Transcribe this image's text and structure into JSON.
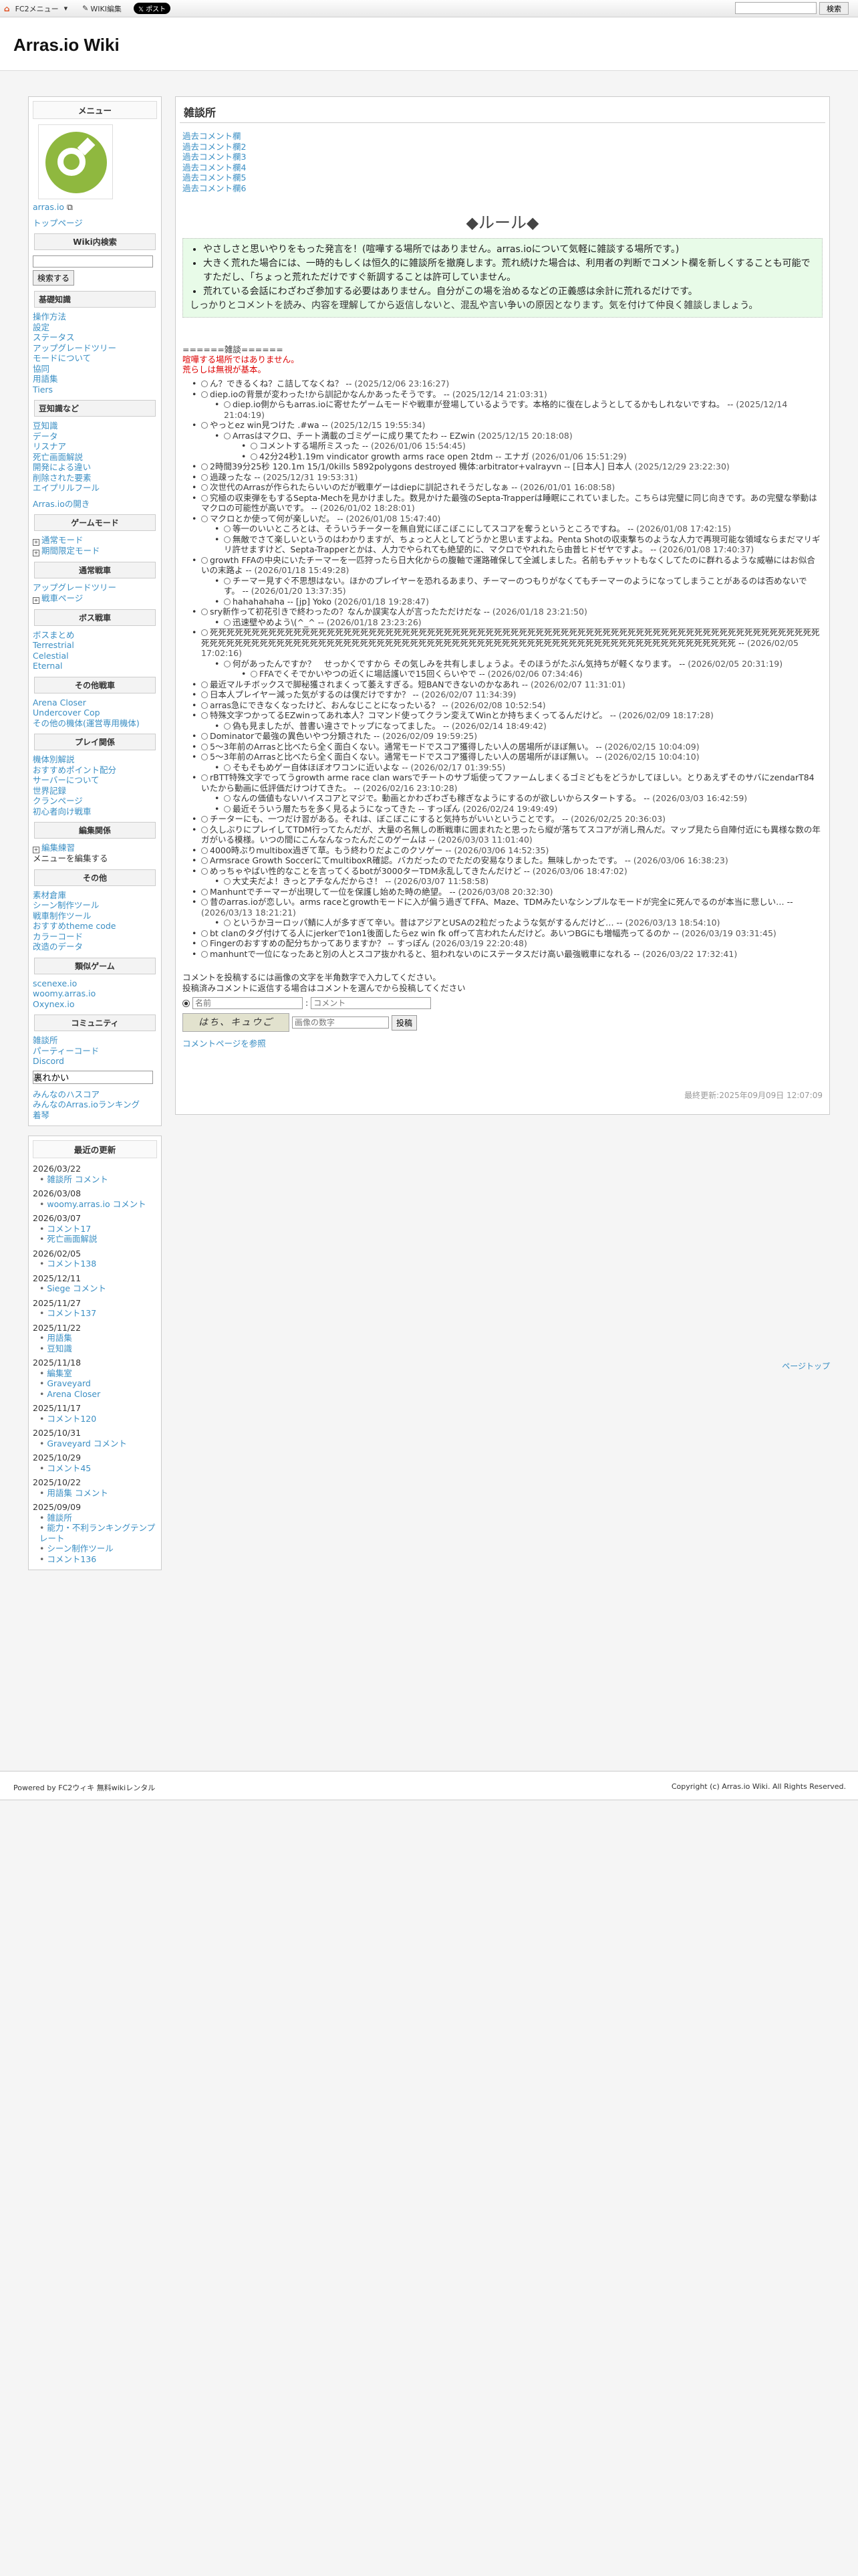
{
  "topbar": {
    "fc2_menu": "FC2メニュー",
    "wiki_edit": "WIKI編集",
    "x_post": "ポスト",
    "search_button": "検索"
  },
  "header": {
    "title": "Arras.io Wiki"
  },
  "sidebar": {
    "menu_title": "メニュー",
    "user": "arras.io",
    "top_page": "トップページ",
    "wiki_search_title": "Wiki内検索",
    "search_button": "検索する",
    "groups": [
      {
        "title": "基礎知識",
        "items": [
          "操作方法",
          "設定",
          "ステータス",
          "アップグレードツリー",
          "モードについて",
          "協同",
          "用語集",
          "Tiers"
        ]
      },
      {
        "title": "豆知識など",
        "items": [
          "豆知識",
          "データ",
          "リスナア",
          "死亡画面解説",
          "開発による違い",
          "削除された要素",
          "エイプリルフール"
        ]
      }
    ],
    "arras_link": "Arras.ioの開き",
    "game_mode_title": "ゲームモード",
    "game_mode_items": [
      "通常モード",
      "期間限定モード"
    ],
    "normal_title": "通常戦車",
    "normal_items": [
      "アップグレードツリー",
      "戦車ページ"
    ],
    "boss_title": "ボス戦車",
    "boss_items": [
      "ボスまとめ",
      "Terrestrial",
      "Celestial",
      "Eternal"
    ],
    "other_title": "その他戦車",
    "other_items": [
      "Arena Closer",
      "Undercover Cop",
      "その他の機体(運営専用機体)"
    ],
    "play_title": "プレイ関係",
    "play_items": [
      "機体別解説",
      "おすすめポイント配分",
      "サーバーについて",
      "世界記録",
      "クランページ",
      "初心者向け戦車"
    ],
    "edit_title": "編集関係",
    "edit_items": [
      "編集練習",
      "メニューを編集する"
    ],
    "misc_title": "その他",
    "misc_items": [
      "素材倉庫",
      "シーン制作ツール",
      "戦車制作ツール",
      "おすすめtheme code",
      "カラーコード",
      "改造のデータ"
    ],
    "similar_title": "類似ゲーム",
    "similar_items": [
      "scenexe.io",
      "woomy.arras.io",
      "Oxynex.io"
    ],
    "community_title": "コミュニティ",
    "community_items": [
      "雑談所",
      "パーティーコード",
      "Discord"
    ],
    "fill_title": "裏れかい",
    "bottom_links": [
      "みんなのハスコア",
      "みんなのArras.ioランキング",
      "着琴"
    ],
    "recent_title": "最近の更新",
    "recent": [
      {
        "date": "2026/03/22",
        "items": [
          "雑談所 コメント"
        ]
      },
      {
        "date": "2026/03/08",
        "items": [
          "woomy.arras.io コメント"
        ]
      },
      {
        "date": "2026/03/07",
        "items": [
          "コメント17",
          "死亡画面解説"
        ]
      },
      {
        "date": "2026/02/05",
        "items": [
          "コメント138"
        ]
      },
      {
        "date": "2025/12/11",
        "items": [
          "Siege コメント"
        ]
      },
      {
        "date": "2025/11/27",
        "items": [
          "コメント137"
        ]
      },
      {
        "date": "2025/11/22",
        "items": [
          "用語集",
          "豆知識"
        ]
      },
      {
        "date": "2025/11/18",
        "items": [
          "編集室",
          "Graveyard",
          "Arena Closer"
        ]
      },
      {
        "date": "2025/11/17",
        "items": [
          "コメント120"
        ]
      },
      {
        "date": "2025/10/31",
        "items": [
          "Graveyard コメント"
        ]
      },
      {
        "date": "2025/10/29",
        "items": [
          "コメント45"
        ]
      },
      {
        "date": "2025/10/22",
        "items": [
          "用語集 コメント"
        ]
      },
      {
        "date": "2025/09/09",
        "items": [
          "雑談所",
          "能力・不利ランキングテンプレート",
          "シーン制作ツール",
          "コメント136"
        ]
      }
    ]
  },
  "main": {
    "title": "雑談所",
    "past_links": [
      "過去コメント欄",
      "過去コメント欄2",
      "過去コメント欄3",
      "過去コメント欄4",
      "過去コメント欄5",
      "過去コメント欄6"
    ],
    "rules_heading": "◆ルール◆",
    "rules": [
      "やさしさと思いやりをもった発言を！(喧嘩する場所ではありません。arras.ioについて気軽に雑談する場所です。)",
      "大きく荒れた場合には、一時的もしくは恒久的に雑談所を撤廃します。荒れ続けた場合は、利用者の判断でコメント欄を新しくすることも可能ですただし、「ちょっと荒れただけですぐ新調することは許可していません。",
      "荒れている会話にわざわざ参加する必要はありません。自分がこの場を治めるなどの正義感は余計に荒れるだけです。"
    ],
    "rules_last": "しっかりとコメントを読み、内容を理解してから返信しないと、混乱や言い争いの原因となります。気を付けて仲良く雑談しましょう。",
    "comment_head": "======雑談======",
    "comment_warn1": "喧嘩する場所ではありません。",
    "comment_warn2": "荒らしは無視が基本。",
    "comments": [
      {
        "lv": 0,
        "text": "ん？できるくね？こ詰してなくね？ --",
        "date": "(2025/12/06 23:16:27)"
      },
      {
        "lv": 0,
        "text": "diep.ioの背景が変わった!から訓記かなんかあったそうです。 --",
        "date": "(2025/12/14 21:03:31)"
      },
      {
        "lv": 1,
        "text": "diep.io側からもarras.ioに寄せたゲームモードや戦車が登場しているようです。本格的に復在しようとしてるかもしれないですね。 --",
        "date": "(2025/12/14 21:04:19)"
      },
      {
        "lv": 0,
        "text": "やっとez win見つけた .#wa --",
        "date": "(2025/12/15 19:55:34)"
      },
      {
        "lv": 1,
        "text": "Arrasはマクロ、チート満載のゴミゲーに成り果てたわ -- EZwin",
        "date": "(2025/12/15 20:18:08)"
      },
      {
        "lv": 2,
        "text": "コメントする場所ミスった --",
        "date": "(2026/01/06 15:54:45)"
      },
      {
        "lv": 2,
        "text": "42分24秒1.19m vindicator growth arms race open 2tdm -- エナガ",
        "date": "(2026/01/06 15:51:29)"
      },
      {
        "lv": 0,
        "text": "2時間39分25秒 120.1m 15/1/0kills 5892polygons destroyed 機体:arbitrator+valrayvn -- [日本人] 日本人",
        "date": "(2025/12/29 23:22:30)"
      },
      {
        "lv": 0,
        "text": "過疎ったな --",
        "date": "(2025/12/31 19:53:31)"
      },
      {
        "lv": 0,
        "text": "次世代のArrasが作られたらいいのだが戦車ゲーはdiepに訓記されそうだしなぁ --",
        "date": "(2026/01/01 16:08:58)"
      },
      {
        "lv": 0,
        "text": "究極の収束弾をもするSepta-Mechを見かけました。数見かけた最強のSepta-Trapperは睡眠にこれていました。こちらは完璧に同じ向きです。あの完璧な挙動はマクロの可能性が高いです。 --",
        "date": "(2026/01/02 18:28:01)"
      },
      {
        "lv": 0,
        "text": "マクロとか使って何が楽しいだ。 --",
        "date": "(2026/01/08 15:47:40)"
      },
      {
        "lv": 1,
        "text": "等一のいいところとは、そういうチーターを無自覚にぼこぼこにしてスコアを奪うというところですね。 --",
        "date": "(2026/01/08 17:42:15)"
      },
      {
        "lv": 1,
        "text": "無敵でさて楽しいというのはわかりますが、ちょっと人としてどうかと思いますよね。Penta Shotの収束撃ちのような人力で再現可能な領域ならまだマリギリ許せますけど、Septa-Trapperとかは、人力でやられても絶望的に、マクロでやれれたら由普ヒドゼヤですよ。 --",
        "date": "(2026/01/08 17:40:37)"
      },
      {
        "lv": 0,
        "text": "growth FFAの中央にいたチーマーを一匹狩ったら日大化からの腹軸で運路確保して全滅しました。名前もチャットもなくしてたのに群れるような威嚇にはお似合いの末路よ --",
        "date": "(2026/01/18 15:49:28)"
      },
      {
        "lv": 1,
        "text": "チーマー見すぐ不思想はない。ほかのプレイヤーを恐れるあまり、チーマーのつもりがなくてもチーマーのようになってしまうことがあるのは否めないです。 --",
        "date": "(2026/01/20 13:37:35)"
      },
      {
        "lv": 1,
        "text": "hahahahaha -- [jp] Yoko",
        "date": "(2026/01/18 19:28:47)"
      },
      {
        "lv": 0,
        "text": "sry新作って初花引きで終わったの？なんか誤実な人が言ったただけだな --",
        "date": "(2026/01/18 23:21:50)"
      },
      {
        "lv": 1,
        "text": "迅速壁やめよう\\(^_^ --",
        "date": "(2026/01/18 23:23:26)"
      },
      {
        "lv": 0,
        "text": "死死死死死死死死死死死死死死死死死死死死死死死死死死死死死死死死死死死死死死死死死死死死死死死死死死死死死死死死死死死死死死死死死死死死死死死死死死死死死死死死死死死死死死死死死死死死死死死死死死死死死死死死死死死死死死死死死死死死死死死死死死死死死死死死死死死死死死死死死 --",
        "date": "(2026/02/05 17:02:16)"
      },
      {
        "lv": 1,
        "text": "何があったんですか？　せっかくですから その気しみを共有しましょうよ。そのほうがたぶん気持ちが軽くなります。 --",
        "date": "(2026/02/05 20:31:19)"
      },
      {
        "lv": 2,
        "text": "FFAでくそでかいやつの近くに場話護いで15回くらいやで --",
        "date": "(2026/02/06 07:34:46)"
      },
      {
        "lv": 0,
        "text": "最近マルチボックスで脚秘獲されまくって萎えすぎる。短BANできないのかなあれ --",
        "date": "(2026/02/07 11:31:01)"
      },
      {
        "lv": 0,
        "text": "日本人プレイヤー減った気がするのは僕だけですか？ --",
        "date": "(2026/02/07 11:34:39)"
      },
      {
        "lv": 0,
        "text": "arras急にできなくなったけど、おんなじことになったいる？ --",
        "date": "(2026/02/08 10:52:54)"
      },
      {
        "lv": 0,
        "text": "特殊文字つかってるEZwinってあれ本人？コマンド使ってクラン変えてWinとか持ちまくってるんだけど。 --",
        "date": "(2026/02/09 18:17:28)"
      },
      {
        "lv": 1,
        "text": "偽も見ましたが、普書い違さでトップになってました。 --",
        "date": "(2026/02/14 18:49:42)"
      },
      {
        "lv": 0,
        "text": "Dominatorで最強の異色いやつ分類された --",
        "date": "(2026/02/09 19:59:25)"
      },
      {
        "lv": 0,
        "text": "5〜3年前のArrasと比べたら全く面白くない。通常モードでスコア獲得したい人の居場所がほぼ無い。 --",
        "date": "(2026/02/15 10:04:09)"
      },
      {
        "lv": 0,
        "text": "5〜3年前のArrasと比べたら全く面白くない。通常モードでスコア獲得したい人の居場所がほぼ無い。 --",
        "date": "(2026/02/15 10:04:10)"
      },
      {
        "lv": 1,
        "text": "そもそもめゲー自体ほぼオワコンに近いよな --",
        "date": "(2026/02/17 01:39:55)"
      },
      {
        "lv": 0,
        "text": "rBTT特殊文字でってうgrowth arme race clan warsでチートのサブ垢使ってファームしまくるゴミどもをどうかしてほしい。とりあえずそのサバにzendarT84いたから動画に低評価だけつけてきた。 --",
        "date": "(2026/02/16 23:10:28)"
      },
      {
        "lv": 1,
        "text": "なんの価値もないハイスコアとマジで。動画とかわざわざも稼ぎなようにするのが欲しいからスタートする。 --",
        "date": "(2026/03/03 16:42:59)"
      },
      {
        "lv": 1,
        "text": "最近そういう層たちを多く見るようになってきた -- すっぽん",
        "date": "(2026/02/24 19:49:49)"
      },
      {
        "lv": 0,
        "text": "チーターにも、一つだけ習がある。それは、ぼこぼこにすると気持ちがいいということです。 --",
        "date": "(2026/02/25 20:36:03)"
      },
      {
        "lv": 0,
        "text": "久しぶりにプレイしてTDM行ってたんだが、大量の名無しの断戦車に囲まれたと思ったら縦が落ちてスコアが消し飛んだ。マップ見たら自陣付近にも異様な数の年ガがいる模様。いつの間にこんなんなったんだこのゲームは --",
        "date": "(2026/03/03 11:01:40)"
      },
      {
        "lv": 0,
        "text": "4000時ぶりmultibox過ぎて草。もう終わりだよこのクソゲー --",
        "date": "(2026/03/06 14:52:35)"
      },
      {
        "lv": 0,
        "text": "Armsrace Growth SoccerにてmultiboxR確認。バカだったのでただの安易なりました。無味しかったです。 --",
        "date": "(2026/03/06 16:38:23)"
      },
      {
        "lv": 0,
        "text": "めっちゃやばい性的なことを言ってくるbotが3000ターTDM永乱してきたんだけど --",
        "date": "(2026/03/06 18:47:02)"
      },
      {
        "lv": 1,
        "text": "大丈夫だよ！きっとアチなんだからさ！ --",
        "date": "(2026/03/07 11:58:58)"
      },
      {
        "lv": 0,
        "text": "Manhuntでチーマーが出現して一位を保護し始めた時の絶望。 --",
        "date": "(2026/03/08 20:32:30)"
      },
      {
        "lv": 0,
        "text": "昔のarras.ioが恋しい。arms raceとgrowthモードに入が偏う過ぎてFFA、Maze、TDMみたいなシンプルなモードが完全に死んでるのが本当に悲しい… --",
        "date": "(2026/03/13 18:21:21)"
      },
      {
        "lv": 1,
        "text": "というかヨーロッパ鯖に人が多すぎて辛い。昔はアジアとUSAの2粒だったような気がするんだけど… --",
        "date": "(2026/03/13 18:54:10)"
      },
      {
        "lv": 0,
        "text": "bt clanのタグ付けてる人にjerkerで1on1後面したらez win fk offって言われたんだけど。あいつBGにも増幅売ってるのか --",
        "date": "(2026/03/19 03:31:45)"
      },
      {
        "lv": 0,
        "text": "Fingerのおすすめの配分ちかってありますか？ -- すっぽん",
        "date": "(2026/03/19 22:20:48)"
      },
      {
        "lv": 0,
        "text": "manhuntで一位になったあと別の人とスコア抜かれると、狙われないのにステータスだけ高い最強戦車になれる --",
        "date": "(2026/03/22 17:32:41)"
      }
    ],
    "post_line1": "コメントを投稿するには画像の文字を半角数字で入力してください。",
    "post_line2": "投稿済みコメントに返信する場合はコメントを選んでから投稿してください",
    "name_placeholder": "名前",
    "comment_placeholder": "コメント",
    "captcha_text": "はち、キュウご",
    "captcha_placeholder": "画像の数字",
    "post_button": "投稿",
    "comment_page_link": "コメントページを参照",
    "last_modified": "最終更新:2025年09月09日 12:07:09"
  },
  "page_top": "ページトップ",
  "footer": {
    "left": "Powered by FC2ウィキ 無料wikiレンタル",
    "right": "Copyright (c) Arras.io Wiki. All Rights Reserved."
  }
}
